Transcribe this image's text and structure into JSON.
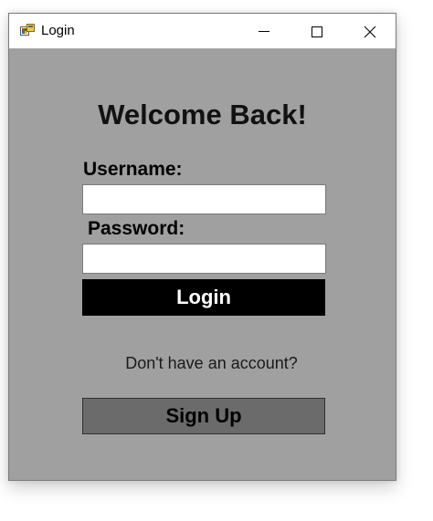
{
  "window": {
    "title": "Login",
    "icon": "winforms-app-icon",
    "controls": {
      "minimize_icon": "minimize-icon",
      "maximize_icon": "maximize-icon",
      "close_icon": "close-icon"
    }
  },
  "form": {
    "heading": "Welcome Back!",
    "username_label": "Username:",
    "username_value": "",
    "password_label": "Password:",
    "password_value": "",
    "login_button": "Login",
    "signup_prompt": "Don't have an account?",
    "signup_button": "Sign Up"
  },
  "colors": {
    "client_background": "#a0a0a0",
    "login_button_bg": "#000000",
    "login_button_text": "#ffffff",
    "signup_button_bg": "#6b6b6b"
  }
}
